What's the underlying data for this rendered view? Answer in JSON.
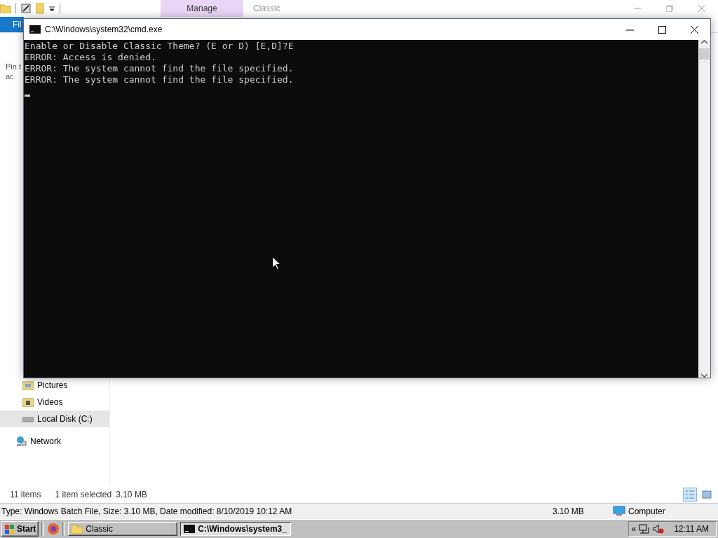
{
  "explorer": {
    "title": "Classic",
    "contextual_tab": "Manage",
    "file_tab": "Fil",
    "ribbon_texts": [
      "Pin t",
      "ac"
    ],
    "nav_items": [
      {
        "label": "Pictures",
        "kind": "pictures",
        "selected": false
      },
      {
        "label": "Videos",
        "kind": "videos",
        "selected": false
      },
      {
        "label": "Local Disk (C:)",
        "kind": "drive",
        "selected": true
      },
      {
        "label": "Network",
        "kind": "network",
        "selected": false
      }
    ],
    "status_bar": {
      "item_count": "11 items",
      "selection": "1 item selected",
      "size": "3.10 MB",
      "views": [
        {
          "kind": "details",
          "selected": true
        },
        {
          "kind": "thumbnails",
          "selected": false
        }
      ]
    },
    "details_bar": {
      "text": "Type: Windows Batch File, Size: 3.10 MB, Date modified: 8/10/2019 10:12 AM",
      "size": "3.10 MB",
      "location": "Computer"
    }
  },
  "console": {
    "title": "C:\\Windows\\system32\\cmd.exe",
    "lines": [
      "Enable or Disable Classic Theme? (E or D) [E,D]?E",
      "ERROR: Access is denied.",
      "ERROR: The system cannot find the file specified.",
      "ERROR: The system cannot find the file specified."
    ]
  },
  "taskbar": {
    "start": "Start",
    "buttons": [
      {
        "label": "Classic",
        "kind": "folder",
        "selected": false
      },
      {
        "label": "C:\\Windows\\system3_",
        "kind": "console",
        "selected": true
      }
    ],
    "tray_expander": "«",
    "clock": "12:11 AM"
  }
}
